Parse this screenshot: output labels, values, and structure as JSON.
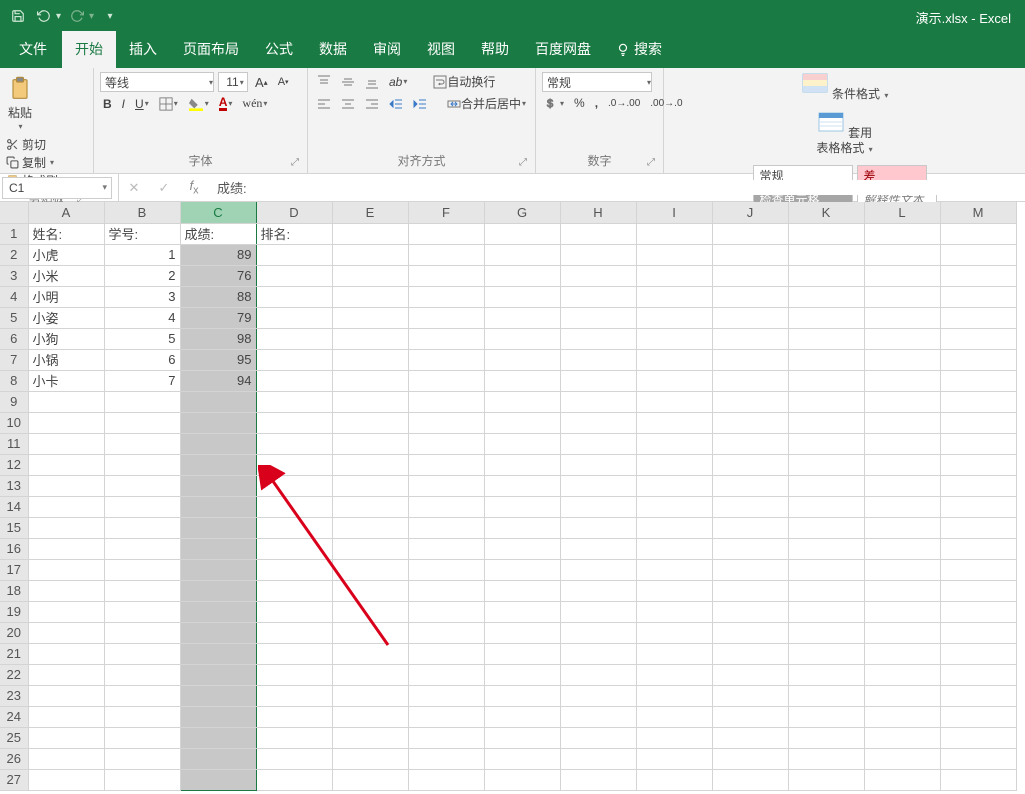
{
  "app_title": "演示.xlsx - Excel",
  "tabs": {
    "file": "文件",
    "home": "开始",
    "insert": "插入",
    "layout": "页面布局",
    "formula": "公式",
    "data": "数据",
    "review": "审阅",
    "view": "视图",
    "help": "帮助",
    "baidu": "百度网盘",
    "search": "搜索"
  },
  "clipboard": {
    "cut": "剪切",
    "copy": "复制",
    "format_painter": "格式刷",
    "paste": "粘贴",
    "group": "剪贴板"
  },
  "font": {
    "name": "等线",
    "size": "11",
    "group": "字体"
  },
  "align": {
    "wrap": "自动换行",
    "merge": "合并后居中",
    "group": "对齐方式"
  },
  "number": {
    "format": "常规",
    "group": "数字"
  },
  "styles": {
    "cond_fmt": "条件格式",
    "table_fmt": "套用\n表格格式",
    "normal": "常规",
    "bad": "差",
    "check_cell": "检查单元格",
    "explain": "解释性文本"
  },
  "formula_bar": {
    "name_box": "C1",
    "formula": "成绩:"
  },
  "columns": [
    "A",
    "B",
    "C",
    "D",
    "E",
    "F",
    "G",
    "H",
    "I",
    "J",
    "K",
    "L",
    "M"
  ],
  "row_count": 27,
  "headers": {
    "A": "姓名:",
    "B": "学号:",
    "C": "成绩:",
    "D": "排名:"
  },
  "rows": [
    {
      "A": "小虎",
      "B": 1,
      "C": 89
    },
    {
      "A": "小米",
      "B": 2,
      "C": 76
    },
    {
      "A": "小明",
      "B": 3,
      "C": 88
    },
    {
      "A": "小姿",
      "B": 4,
      "C": 79
    },
    {
      "A": "小狗",
      "B": 5,
      "C": 98
    },
    {
      "A": "小锅",
      "B": 6,
      "C": 95
    },
    {
      "A": "小卡",
      "B": 7,
      "C": 94
    }
  ],
  "selected_column": "C",
  "active_cell": "C1"
}
